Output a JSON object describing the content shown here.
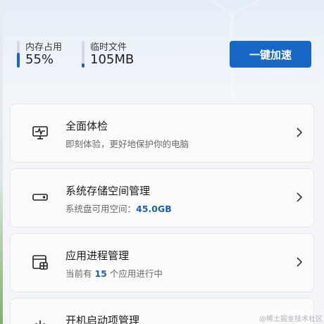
{
  "stats": [
    {
      "label": "内存占用",
      "value": "55%",
      "level": 0.55
    },
    {
      "label": "临时文件",
      "value": "105MB",
      "level": 0.15
    }
  ],
  "boost_label": "一键加速",
  "cards": [
    {
      "title": "全面体检",
      "sub_pre": "即刻体验，更好地保护你的电脑",
      "sub_hl": "",
      "sub_post": "",
      "icon": "monitor-pulse-icon"
    },
    {
      "title": "系统存储空间管理",
      "sub_pre": "系统盘可用空间：",
      "sub_hl": "45.0GB",
      "sub_post": "",
      "icon": "storage-drive-icon"
    },
    {
      "title": "应用进程管理",
      "sub_pre": "当前有 ",
      "sub_hl": "15",
      "sub_post": " 个应用进行中",
      "icon": "app-window-icon"
    },
    {
      "title": "开机启动项管理",
      "sub_pre": "",
      "sub_hl": "",
      "sub_post": "",
      "icon": "power-icon"
    }
  ],
  "watermark": "@稀土掘金技术社区",
  "colors": {
    "accent": "#1866c6",
    "highlight": "#1e5fb4"
  }
}
